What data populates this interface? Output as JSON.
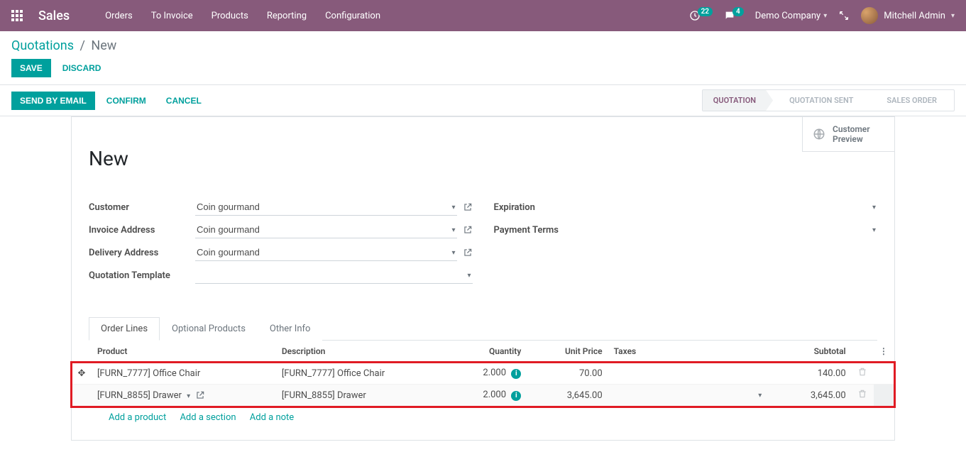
{
  "topbar": {
    "brand": "Sales",
    "menu": [
      "Orders",
      "To Invoice",
      "Products",
      "Reporting",
      "Configuration"
    ],
    "activities_count": "22",
    "messages_count": "4",
    "company": "Demo Company",
    "user": "Mitchell Admin"
  },
  "breadcrumb": {
    "root": "Quotations",
    "current": "New"
  },
  "buttons": {
    "save": "SAVE",
    "discard": "DISCARD",
    "send_email": "SEND BY EMAIL",
    "confirm": "CONFIRM",
    "cancel": "CANCEL"
  },
  "status_steps": {
    "quotation": "QUOTATION",
    "quotation_sent": "QUOTATION SENT",
    "sales_order": "SALES ORDER"
  },
  "customer_preview": {
    "line1": "Customer",
    "line2": "Preview"
  },
  "title": "New",
  "form": {
    "labels": {
      "customer": "Customer",
      "invoice_address": "Invoice Address",
      "delivery_address": "Delivery Address",
      "quotation_template": "Quotation Template",
      "expiration": "Expiration",
      "payment_terms": "Payment Terms"
    },
    "values": {
      "customer": "Coin gourmand",
      "invoice_address": "Coin gourmand",
      "delivery_address": "Coin gourmand",
      "quotation_template": "",
      "expiration": "",
      "payment_terms": ""
    }
  },
  "tabs": {
    "order_lines": "Order Lines",
    "optional_products": "Optional Products",
    "other_info": "Other Info"
  },
  "table": {
    "headers": {
      "product": "Product",
      "description": "Description",
      "quantity": "Quantity",
      "unit_price": "Unit Price",
      "taxes": "Taxes",
      "subtotal": "Subtotal"
    },
    "rows": [
      {
        "product": "[FURN_7777] Office Chair",
        "description": "[FURN_7777] Office Chair",
        "quantity": "2.000",
        "unit_price": "70.00",
        "taxes": "",
        "subtotal": "140.00"
      },
      {
        "product": "[FURN_8855] Drawer",
        "description": "[FURN_8855] Drawer",
        "quantity": "2.000",
        "unit_price": "3,645.00",
        "taxes": "",
        "subtotal": "3,645.00"
      }
    ],
    "add_links": {
      "product": "Add a product",
      "section": "Add a section",
      "note": "Add a note"
    }
  }
}
